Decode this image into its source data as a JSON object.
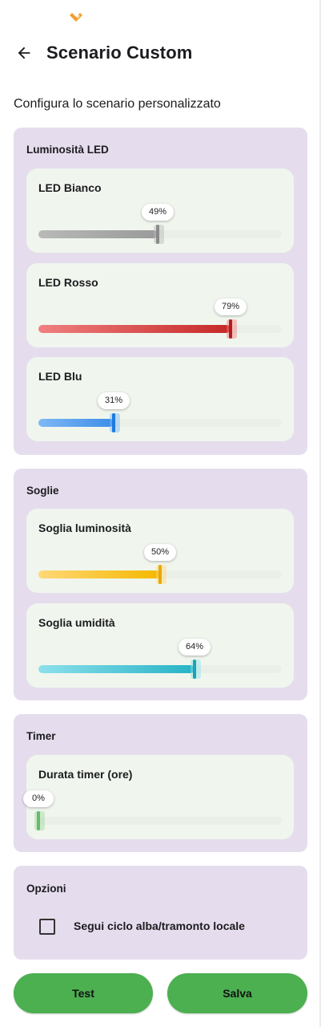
{
  "header": {
    "title": "Scenario Custom"
  },
  "subtitle": "Configura lo scenario personalizzato",
  "sections": {
    "led": {
      "title": "Luminosità LED",
      "sliders": [
        {
          "label": "LED Bianco",
          "value_text": "49%",
          "value": 0.49,
          "color": "#b9b9b9",
          "color_dark": "#9a9a9a",
          "thumb": "#8a8a8a"
        },
        {
          "label": "LED Rosso",
          "value_text": "79%",
          "value": 0.79,
          "color": "#f08080",
          "color_dark": "#c62828",
          "thumb": "#b71c1c"
        },
        {
          "label": "LED Blu",
          "value_text": "31%",
          "value": 0.31,
          "color": "#7fb8f5",
          "color_dark": "#3d8ee8",
          "thumb": "#1e7ae0"
        }
      ]
    },
    "thresholds": {
      "title": "Soglie",
      "sliders": [
        {
          "label": "Soglia luminosità",
          "value_text": "50%",
          "value": 0.5,
          "color": "#ffd877",
          "color_dark": "#f5b800",
          "thumb": "#e8a800"
        },
        {
          "label": "Soglia umidità",
          "value_text": "64%",
          "value": 0.64,
          "color": "#8de0ec",
          "color_dark": "#26b3c6",
          "thumb": "#1aa3b5"
        }
      ]
    },
    "timer": {
      "title": "Timer",
      "sliders": [
        {
          "label": "Durata timer (ore)",
          "value_text": "0%",
          "value": 0.0,
          "color": "#9fd69f",
          "color_dark": "#66bb6a",
          "thumb": "#66bb6a"
        }
      ]
    },
    "options": {
      "title": "Opzioni",
      "checkbox_label": "Segui ciclo alba/tramonto locale",
      "checked": false
    }
  },
  "buttons": {
    "test": "Test",
    "save": "Salva"
  }
}
